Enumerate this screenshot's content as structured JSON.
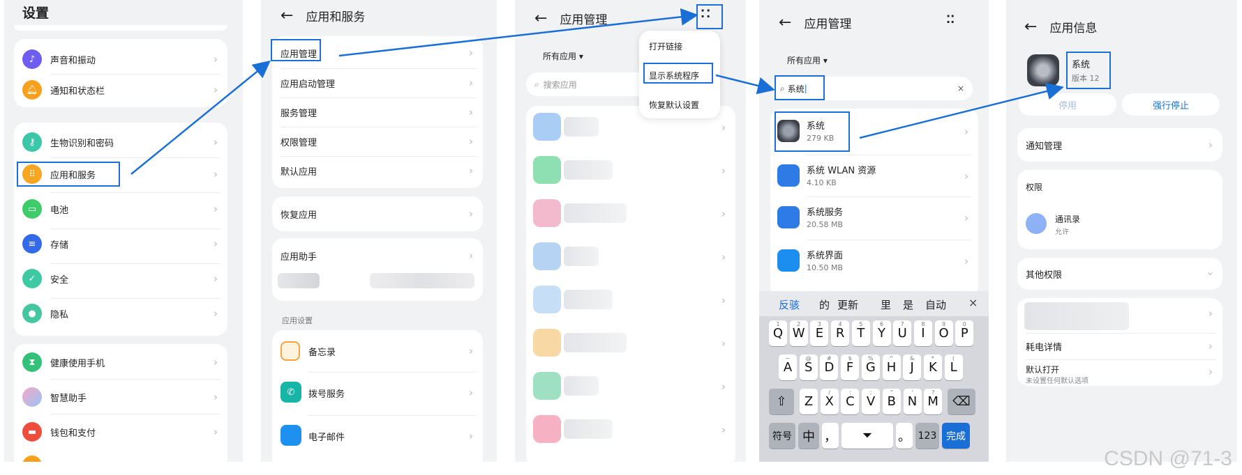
{
  "panel1": {
    "title": "设置",
    "items": [
      {
        "label": "声音和振动",
        "color": "#6f5cf0",
        "icon": "speaker-icon"
      },
      {
        "label": "通知和状态栏",
        "color": "#f6a11e",
        "icon": "bell-icon"
      },
      {
        "label": "生物识别和密码",
        "color": "#3cc7a8",
        "icon": "key-icon"
      },
      {
        "label": "应用和服务",
        "color": "#f7a622",
        "icon": "apps-icon"
      },
      {
        "label": "电池",
        "color": "#3ecb6a",
        "icon": "battery-icon"
      },
      {
        "label": "存储",
        "color": "#3469e8",
        "icon": "storage-icon"
      },
      {
        "label": "安全",
        "color": "#3fc9a3",
        "icon": "shield-icon"
      },
      {
        "label": "隐私",
        "color": "#44c7a1",
        "icon": "privacy-icon"
      },
      {
        "label": "健康使用手机",
        "color": "#33c07a",
        "icon": "hourglass-icon"
      },
      {
        "label": "智慧助手",
        "color": "#c39ae8",
        "icon": "assistant-icon"
      },
      {
        "label": "钱包和支付",
        "color": "#ee4d3b",
        "icon": "wallet-icon"
      }
    ]
  },
  "panel2": {
    "title": "应用和服务",
    "group1": [
      "应用管理",
      "应用启动管理",
      "服务管理",
      "权限管理",
      "默认应用"
    ],
    "restore": "恢复应用",
    "assistant": "应用助手",
    "section": "应用设置",
    "apps": [
      {
        "label": "备忘录",
        "color": "#f5a43b",
        "icon": "memo-icon"
      },
      {
        "label": "拨号服务",
        "color": "#16b5a6",
        "icon": "phone-icon"
      },
      {
        "label": "电子邮件",
        "color": "#1e90f0",
        "icon": "email-icon"
      }
    ]
  },
  "panel3": {
    "title": "应用管理",
    "filter": "所有应用",
    "search_placeholder": "搜索应用",
    "menu": [
      "打开链接",
      "显示系统程序",
      "恢复默认设置"
    ],
    "blurred_rows": 8
  },
  "panel4": {
    "title": "应用管理",
    "filter": "所有应用",
    "search_value": "系统",
    "clear": "×",
    "results": [
      {
        "name": "系统",
        "size": "279 KB",
        "icon": "gear-icon",
        "color": "#3b3f48"
      },
      {
        "name": "系统 WLAN 资源",
        "size": "4.10 KB",
        "icon": "puzzle-icon",
        "color": "#2f7be6"
      },
      {
        "name": "系统服务",
        "size": "20.58 MB",
        "icon": "puzzle-icon",
        "color": "#2f7be6"
      },
      {
        "name": "系统界面",
        "size": "10.50 MB",
        "icon": "screen-icon",
        "color": "#1b8ef0"
      }
    ],
    "keyboard": {
      "candidates": [
        "反骇",
        "的",
        "更新",
        "里",
        "是",
        "自动"
      ],
      "row1": [
        "Q",
        "W",
        "E",
        "R",
        "T",
        "Y",
        "U",
        "I",
        "O",
        "P"
      ],
      "row1_sup": [
        "1",
        "2",
        "3",
        "4",
        "5",
        "6",
        "7",
        "8",
        "9",
        "0"
      ],
      "row2": [
        "A",
        "S",
        "D",
        "F",
        "G",
        "H",
        "J",
        "K",
        "L"
      ],
      "row2_sup": [
        "~",
        "@",
        "#",
        "$",
        "%",
        "^",
        "&",
        "*",
        "("
      ],
      "row3": [
        "Z",
        "X",
        "C",
        "V",
        "B",
        "N",
        "M"
      ],
      "row3_sup": [
        "",
        "/",
        ":",
        ";",
        "\"",
        "'",
        "?"
      ],
      "key_symbols": "符号",
      "key_lang": "中",
      "key_comma": "，",
      "key_period": "。",
      "key_123": "123",
      "key_done": "完成"
    }
  },
  "panel5": {
    "title": "应用信息",
    "app_name": "系统",
    "version": "版本 12",
    "btn_disable": "停用",
    "btn_force_stop": "强行停止",
    "notification": "通知管理",
    "permissions": "权限",
    "perm_item": "通讯录",
    "perm_state": "允许",
    "other_permissions": "其他权限",
    "power_details": "耗电详情",
    "default_open": "默认打开",
    "default_open_sub": "未设置任何默认选项"
  },
  "watermark": "CSDN @71-3",
  "colors": {
    "highlight": "#1a6fd6",
    "accent": "#1a6fd6"
  }
}
